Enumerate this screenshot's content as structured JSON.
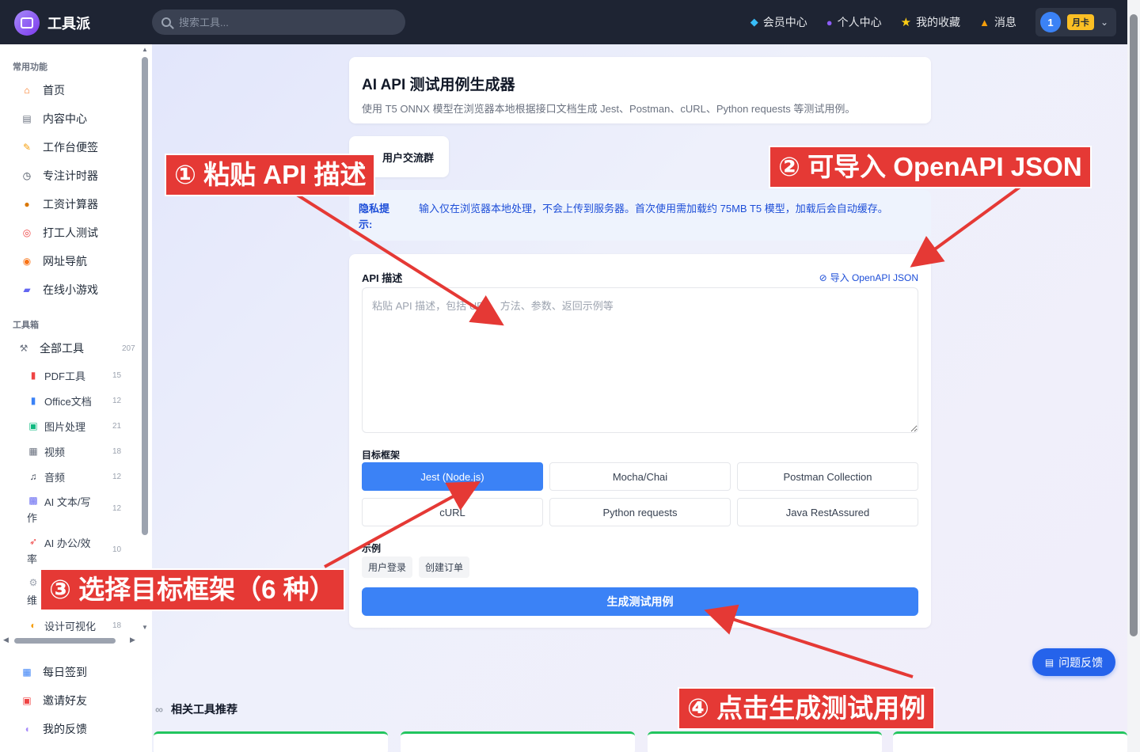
{
  "app": {
    "name": "工具派"
  },
  "search": {
    "placeholder": "搜索工具..."
  },
  "topnav": {
    "vip": "会员中心",
    "profile": "个人中心",
    "favorites": "我的收藏",
    "messages": "消息",
    "user_number": "1",
    "plan_badge": "月卡"
  },
  "sidebar": {
    "section_common": "常用功能",
    "common_items": [
      {
        "label": "首页",
        "icon": "home-icon"
      },
      {
        "label": "内容中心",
        "icon": "newspaper-icon"
      },
      {
        "label": "工作台便签",
        "icon": "memo-icon"
      },
      {
        "label": "专注计时器",
        "icon": "stopwatch-icon"
      },
      {
        "label": "工资计算器",
        "icon": "money-bag-icon"
      },
      {
        "label": "打工人测试",
        "icon": "target-icon"
      },
      {
        "label": "网址导航",
        "icon": "compass-icon"
      },
      {
        "label": "在线小游戏",
        "icon": "gamepad-icon"
      }
    ],
    "section_tools": "工具箱",
    "all_tools": {
      "label": "全部工具",
      "count": "207"
    },
    "tool_items": [
      {
        "label": "PDF工具",
        "count": "15"
      },
      {
        "label": "Office文档",
        "count": "12"
      },
      {
        "label": "图片处理",
        "count": "21"
      },
      {
        "label": "视频",
        "count": "18"
      },
      {
        "label": "音频",
        "count": "12"
      },
      {
        "label_1": "AI 文本/写",
        "label_2": "作",
        "count": "12"
      },
      {
        "label_1": "AI 办公/效",
        "label_2": "率",
        "count": "10"
      },
      {
        "label_2": "维"
      },
      {
        "label": "设计可视化",
        "count": "18"
      }
    ],
    "bottom_items": [
      {
        "label": "每日签到"
      },
      {
        "label": "邀请好友"
      },
      {
        "label": "我的反馈"
      }
    ]
  },
  "main": {
    "title": "AI API 测试用例生成器",
    "subtitle": "使用 T5 ONNX 模型在浏览器本地根据接口文档生成 Jest、Postman、cURL、Python requests 等测试用例。",
    "group_label": "用户交流群",
    "privacy_label_1": "隐私提",
    "privacy_label_2": "示:",
    "privacy_text": "输入仅在浏览器本地处理，不会上传到服务器。首次使用需加载约 75MB T5 模型，加载后会自动缓存。",
    "api_label": "API 描述",
    "import_label": "导入 OpenAPI JSON",
    "textarea_placeholder": "粘贴 API 描述，包括 URL、方法、参数、返回示例等",
    "framework_label": "目标框架",
    "frameworks": [
      "Jest (Node.js)",
      "Mocha/Chai",
      "Postman Collection",
      "cURL",
      "Python requests",
      "Java RestAssured"
    ],
    "selected_framework": "Jest (Node.js)",
    "examples_label": "示例",
    "examples": [
      "用户登录",
      "创建订单"
    ],
    "generate_label": "生成测试用例"
  },
  "related": {
    "title": "相关工具推荐"
  },
  "feedback": {
    "label": "问题反馈"
  },
  "annotations": {
    "step1": "① 粘贴 API 描述",
    "step2": "② 可导入 OpenAPI JSON",
    "step3": "③ 选择目标框架（6 种）",
    "step4": "④ 点击生成测试用例"
  },
  "colors": {
    "accent": "#3b82f6",
    "topbar": "#1e2433",
    "annotation": "#e53935",
    "privacy_text": "#1d4ed8"
  }
}
